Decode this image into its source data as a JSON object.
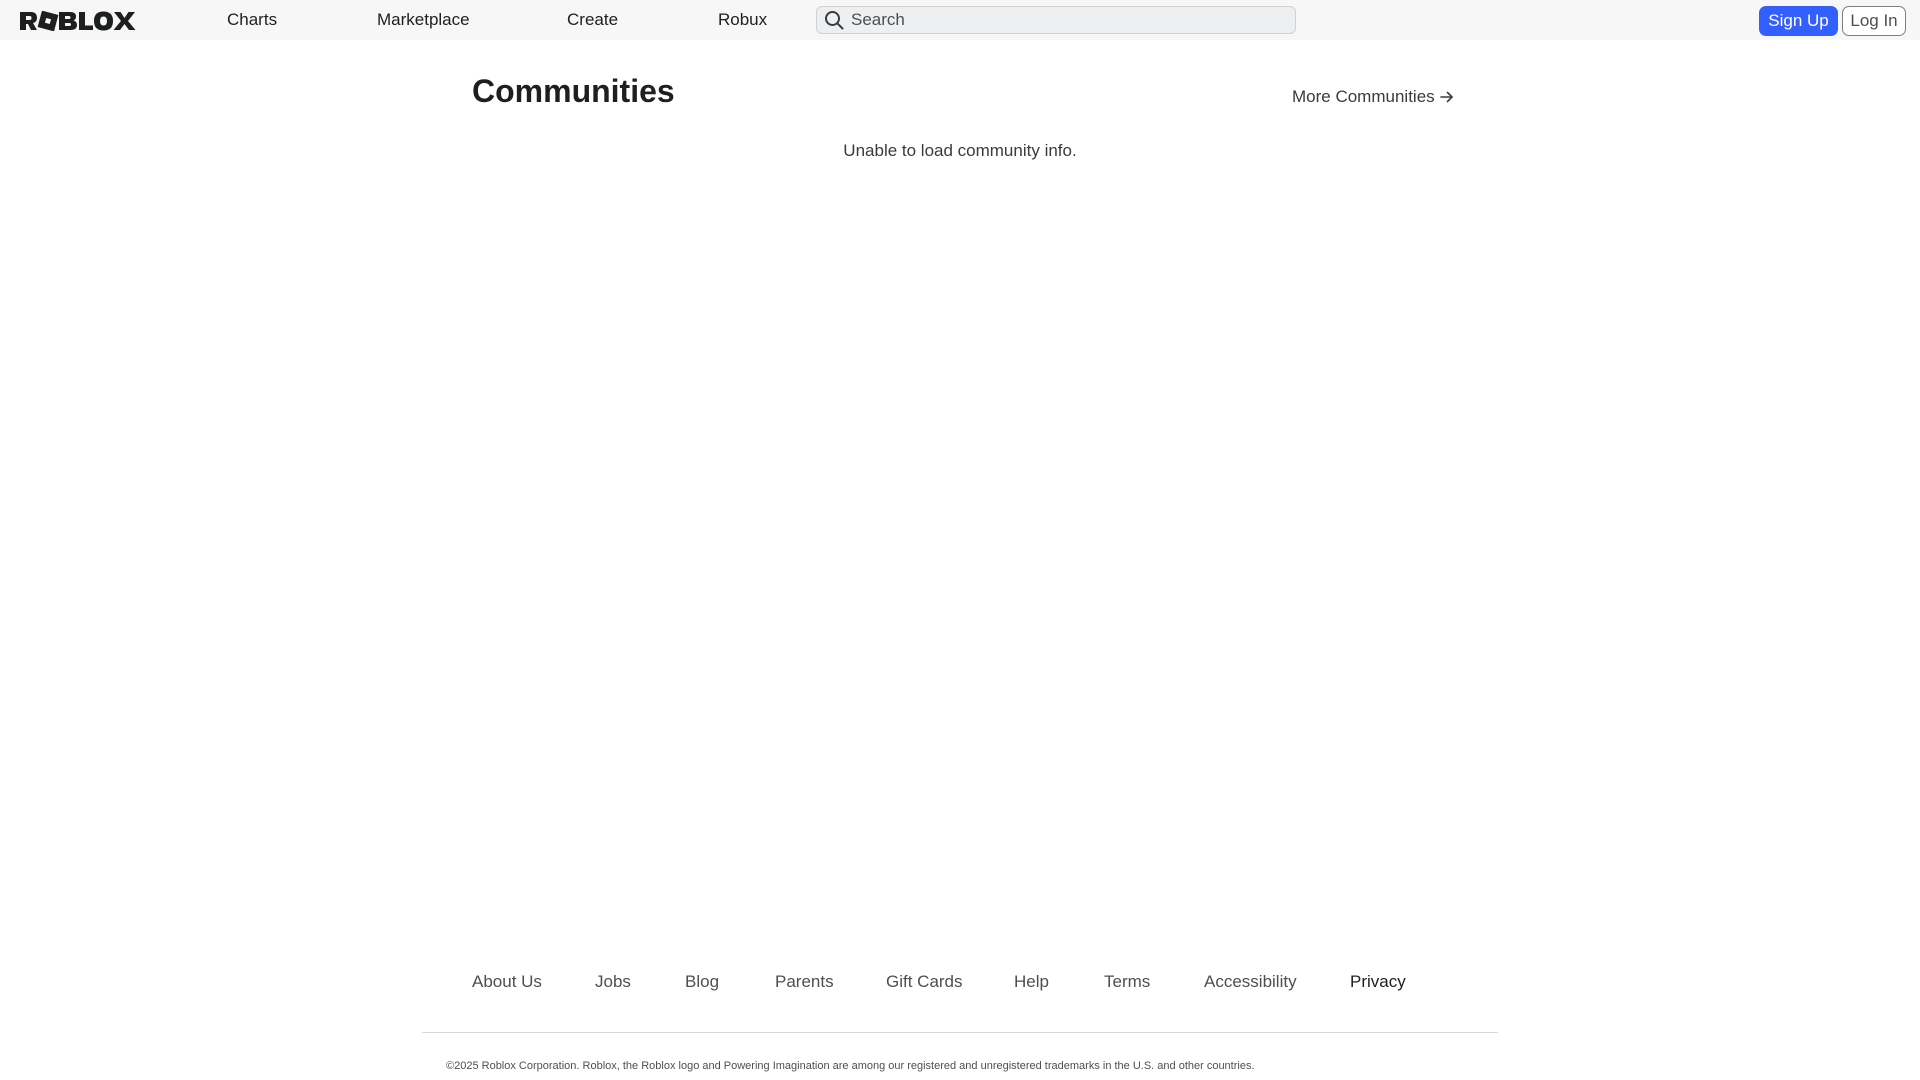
{
  "header": {
    "logo_text": "ROBLOX",
    "nav": [
      "Charts",
      "Marketplace",
      "Create",
      "Robux"
    ],
    "search": {
      "placeholder": "Search",
      "value": "",
      "icon": "search-icon"
    },
    "signup_label": "Sign Up",
    "login_label": "Log In",
    "accent_color": "#335fff"
  },
  "main": {
    "title": "Communities",
    "more_link": "More Communities",
    "more_icon": "arrow-right-icon",
    "error": "Unable to load community info."
  },
  "footer": {
    "links": [
      "About Us",
      "Jobs",
      "Blog",
      "Parents",
      "Gift Cards",
      "Help",
      "Terms",
      "Accessibility",
      "Privacy"
    ],
    "copyright": "©2025 Roblox Corporation. Roblox, the Roblox logo and Powering Imagination are among our registered and unregistered trademarks in the U.S. and other countries."
  }
}
